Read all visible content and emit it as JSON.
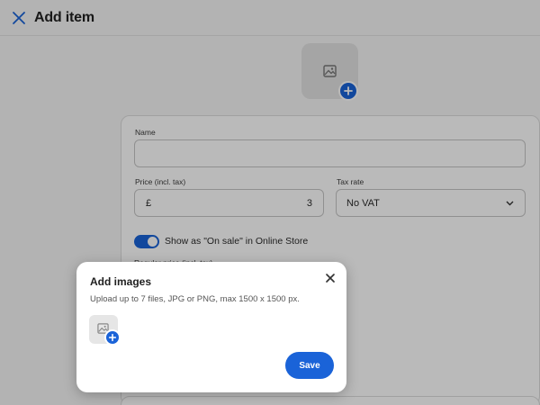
{
  "header": {
    "title": "Add item",
    "close_icon": "close-icon"
  },
  "image_upload": {
    "placeholder_icon": "image-icon",
    "add_icon": "plus-icon"
  },
  "form": {
    "name_label": "Name",
    "name_value": "",
    "price_label": "Price (incl. tax)",
    "price_currency": "£",
    "price_value": "3",
    "tax_label": "Tax rate",
    "tax_value": "No VAT",
    "on_sale_label": "Show as \"On sale\" in Online Store",
    "on_sale_enabled": true,
    "regular_price_label": "Regular price (incl. tax)"
  },
  "modal": {
    "title": "Add images",
    "description": "Upload up to 7 files, JPG or PNG, max 1500 x 1500 px.",
    "save_label": "Save",
    "close_icon": "close-icon"
  },
  "colors": {
    "accent": "#1a63d8",
    "overlay": "rgba(0,0,0,0.27)"
  }
}
